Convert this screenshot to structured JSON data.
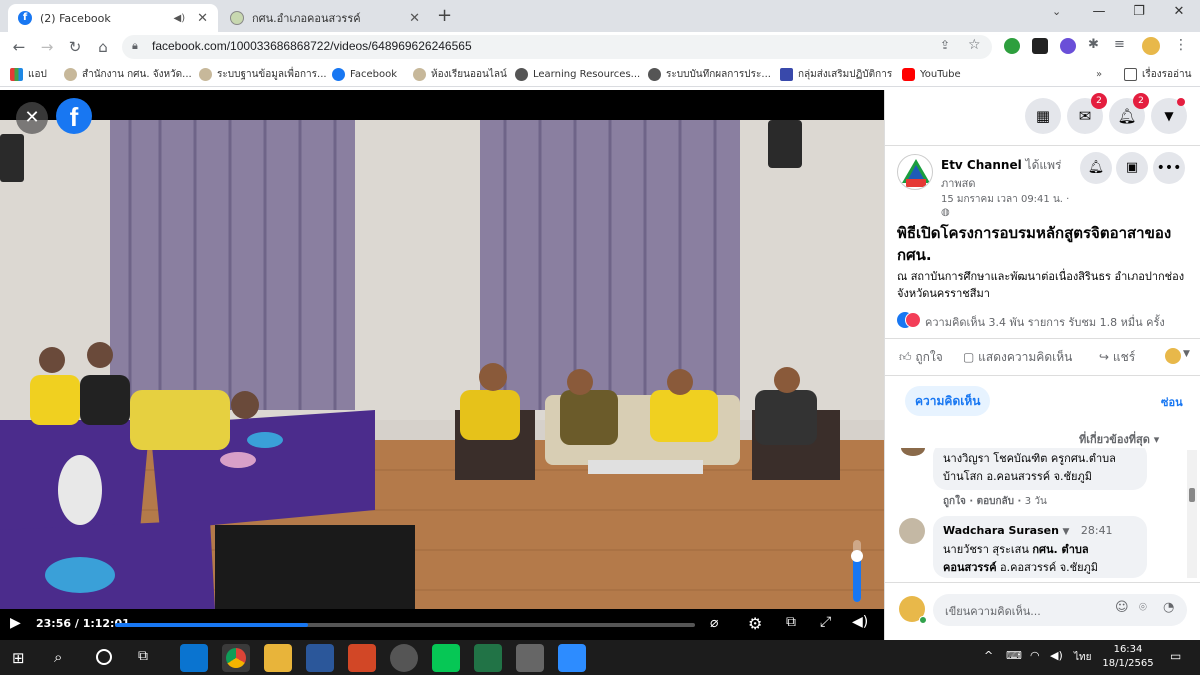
{
  "browser": {
    "tabs": [
      {
        "title": "(2) Facebook",
        "active": true
      },
      {
        "title": "กศน.อำเภอคอนสวรรค์",
        "active": false
      }
    ],
    "new_tab_icon": "plus-icon",
    "url": "facebook.com/100033686868722/videos/648969626246565",
    "bookmarks": [
      {
        "label": "แอป"
      },
      {
        "label": "สำนักงาน กศน. จังหวัด..."
      },
      {
        "label": "ระบบฐานข้อมูลเพื่อการ..."
      },
      {
        "label": "Facebook"
      },
      {
        "label": "ห้องเรียนออนไลน์"
      },
      {
        "label": "Learning Resources..."
      },
      {
        "label": "ระบบบันทึกผลการประ..."
      },
      {
        "label": "กลุ่มส่งเสริมปฏิบัติการ"
      },
      {
        "label": "YouTube"
      },
      {
        "label": "เรื่องรออ่าน"
      }
    ],
    "colors": {
      "accent": "#1877f2",
      "tabstrip": "#dee1e6"
    }
  },
  "video": {
    "current_time": "23:56",
    "duration": "1:12:01",
    "time_display": "23:56 / 1:12:01",
    "progress": 0.332,
    "volume": 0.75
  },
  "header": {
    "messenger_badge": "2",
    "notifications_badge": "2"
  },
  "post": {
    "channel_name": "Etv Channel",
    "live_text": "ได้แพร่",
    "live_text2": "ภาพสด",
    "timestamp": "15 มกราคม เวลา 09:41 น. ·",
    "title": "พิธีเปิดโครงการอบรมหลักสูตรจิตอาสาของ กศน.",
    "description": "ณ สถาบันการศึกษาและพัฒนาต่อเนื่องสิรินธร อำเภอปากช่อง จังหวัดนครราชสีมา",
    "stats": "ความคิดเห็น 3.4 พัน รายการ  รับชม 1.8 หมื่น ครั้ง",
    "like_label": "ถูกใจ",
    "comment_label": "แสดงความคิดเห็น",
    "share_label": "แชร์",
    "comments_tab": "ความคิดเห็น",
    "hide_label": "ซ่อน",
    "sort_label": "ที่เกี่ยวข้องที่สุด"
  },
  "comments": [
    {
      "text_line1": "นางวิญรา โชคบัณฑิต ครูกศน.ตำบล",
      "text_line2": "บ้านโสก อ.คอนสวรรค์ จ.ชัยภูมิ",
      "like": "ถูกใจ",
      "reply": "ตอบกลับ",
      "age": "3 วัน"
    },
    {
      "author": "Wadchara Surasen",
      "time": "28:41",
      "text_line1a": "นายวัชรา สุระเสน ",
      "text_line1b": "กศน. ตำบล",
      "text_line2a": "คอนสวรรค์",
      "text_line2b": " อ.คอสวรรค์ จ.ชัยภูมิ"
    }
  ],
  "composer": {
    "placeholder": "เขียนความคิดเห็น..."
  },
  "taskbar": {
    "lang": "ไทย",
    "time": "16:34",
    "date": "18/1/2565"
  }
}
